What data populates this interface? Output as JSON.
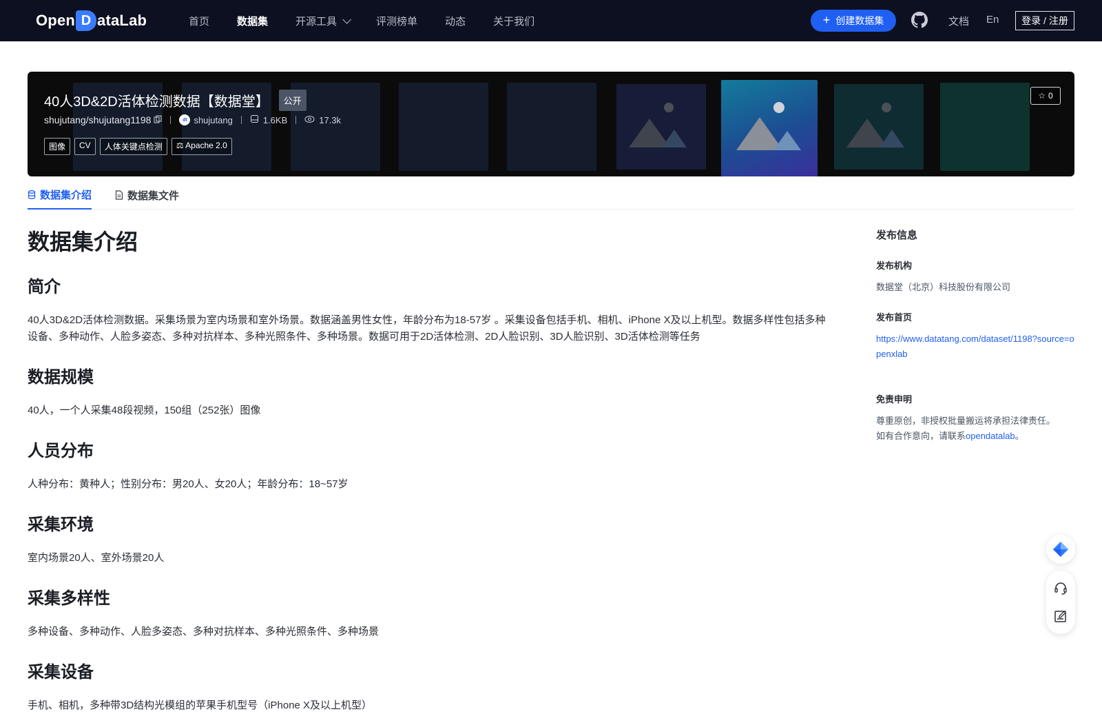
{
  "nav": {
    "logo_text_left": "Open",
    "logo_text_mark": "D",
    "logo_text_right": "ataLab",
    "links": [
      "首页",
      "数据集",
      "开源工具",
      "评测榜单",
      "动态",
      "关于我们"
    ],
    "active_index": 1,
    "create_label": "创建数据集",
    "docs_label": "文档",
    "lang_label": "En",
    "login_label": "登录 / 注册",
    "github_icon": "github-icon"
  },
  "dataset": {
    "title": "40人3D&2D活体检测数据【数据堂】",
    "visibility": "公开",
    "path": "shujutang/shujutang1198",
    "publisher": "shujutang",
    "size": "1.6KB",
    "views": "17.3k",
    "tags": [
      "图像",
      "CV",
      "人体关键点检测"
    ],
    "license": "Apache 2.0",
    "stars": "0"
  },
  "tabs": {
    "intro": "数据集介绍",
    "files": "数据集文件"
  },
  "content": {
    "heading": "数据集介绍",
    "sections": [
      {
        "title": "简介",
        "body": "40人3D&2D活体检测数据。采集场景为室内场景和室外场景。数据涵盖男性女性，年龄分布为18-57岁 。采集设备包括手机、相机、iPhone X及以上机型。数据多样性包括多种设备、多种动作、人脸多姿态、多种对抗样本、多种光照条件、多种场景。数据可用于2D活体检测、2D人脸识别、3D人脸识别、3D活体检测等任务"
      },
      {
        "title": "数据规模",
        "body": "40人，一个人采集48段视频，150组（252张）图像"
      },
      {
        "title": "人员分布",
        "body": "人种分布：黄种人；性别分布：男20人、女20人；年龄分布：18~57岁"
      },
      {
        "title": "采集环境",
        "body": "室内场景20人、室外场景20人"
      },
      {
        "title": "采集多样性",
        "body": "多种设备、多种动作、人脸多姿态、多种对抗样本、多种光照条件、多种场景"
      },
      {
        "title": "采集设备",
        "body": "手机、相机，多种带3D结构光模组的苹果手机型号（iPhone X及以上机型）"
      }
    ]
  },
  "side": {
    "title": "发布信息",
    "org_label": "发布机构",
    "org_value": "数据堂（北京）科技股份有限公司",
    "home_label": "发布首页",
    "home_url": "https://www.datatang.com/dataset/1198?source=openxlab",
    "disclaimer_label": "免责申明",
    "disclaimer_line1": "尊重原创，非授权批量搬运将承担法律责任。",
    "disclaimer_line2_prefix": "如有合作意向，请联系",
    "disclaimer_link": "opendatalab",
    "disclaimer_line2_suffix": "。"
  },
  "colors": {
    "nav_bg": "#0d1020",
    "accent": "#1f5ff2",
    "banner_bg": "#0b0b0c"
  }
}
